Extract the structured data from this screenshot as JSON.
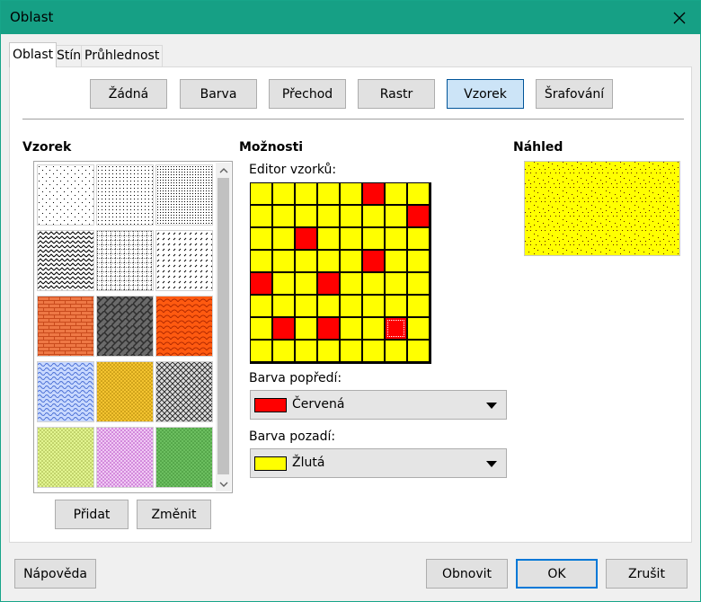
{
  "window": {
    "title": "Oblast"
  },
  "tabs": [
    {
      "label": "Oblast",
      "active": true
    },
    {
      "label": "Stín",
      "active": false
    },
    {
      "label": "Průhlednost",
      "active": false
    }
  ],
  "fill_types": [
    {
      "label": "Žádná",
      "selected": false
    },
    {
      "label": "Barva",
      "selected": false
    },
    {
      "label": "Přechod",
      "selected": false
    },
    {
      "label": "Rastr",
      "selected": false
    },
    {
      "label": "Vzorek",
      "selected": true
    },
    {
      "label": "Šrafování",
      "selected": false
    }
  ],
  "sections": {
    "pattern": "Vzorek",
    "options": "Možnosti",
    "preview": "Náhled"
  },
  "gallery": {
    "tiles": [
      {
        "style": "dots-sparse",
        "fg": "#000000",
        "bg": "#ffffff"
      },
      {
        "style": "dots-medium",
        "fg": "#000000",
        "bg": "#ffffff"
      },
      {
        "style": "dots-dense",
        "fg": "#000000",
        "bg": "#ffffff"
      },
      {
        "style": "zigzag",
        "fg": "#000000",
        "bg": "#ffffff"
      },
      {
        "style": "grid",
        "fg": "#000000",
        "bg": "#ffffff"
      },
      {
        "style": "dashes",
        "fg": "#000000",
        "bg": "#ffffff"
      },
      {
        "style": "brick",
        "fg": "#c84a1c",
        "bg": "#ee7845"
      },
      {
        "style": "weave",
        "fg": "#2e2e2e",
        "bg": "#6a6a6a"
      },
      {
        "style": "scales",
        "fg": "#b22a00",
        "bg": "#ff5a10"
      },
      {
        "style": "waves",
        "fg": "#4a6fd4",
        "bg": "#c9d9ff"
      },
      {
        "style": "stipple",
        "fg": "#a77d00",
        "bg": "#f4c430"
      },
      {
        "style": "lattice",
        "fg": "#222222",
        "bg": "#dcdcdc"
      },
      {
        "style": "stipple",
        "fg": "#9aaa40",
        "bg": "#e2f590"
      },
      {
        "style": "stipple",
        "fg": "#b040c0",
        "bg": "#f0c8f4"
      },
      {
        "style": "stipple",
        "fg": "#3a8a30",
        "bg": "#6cbf60"
      }
    ]
  },
  "buttons": {
    "add": "Přidat",
    "modify": "Změnit",
    "help": "Nápověda",
    "reset": "Obnovit",
    "ok": "OK",
    "cancel": "Zrušit"
  },
  "editor": {
    "label": "Editor vzorků:",
    "size": 8,
    "on_cells": [
      [
        0,
        5
      ],
      [
        1,
        7
      ],
      [
        2,
        2
      ],
      [
        3,
        5
      ],
      [
        4,
        0
      ],
      [
        4,
        3
      ],
      [
        6,
        1
      ],
      [
        6,
        3
      ],
      [
        6,
        6
      ]
    ],
    "selected_cell": [
      6,
      6
    ],
    "fg": "#ff0000",
    "bg": "#ffff00"
  },
  "foreground": {
    "label": "Barva popředí:",
    "value": "Červená",
    "color": "#ff0000"
  },
  "background": {
    "label": "Barva pozadí:",
    "value": "Žlutá",
    "color": "#ffff00"
  }
}
